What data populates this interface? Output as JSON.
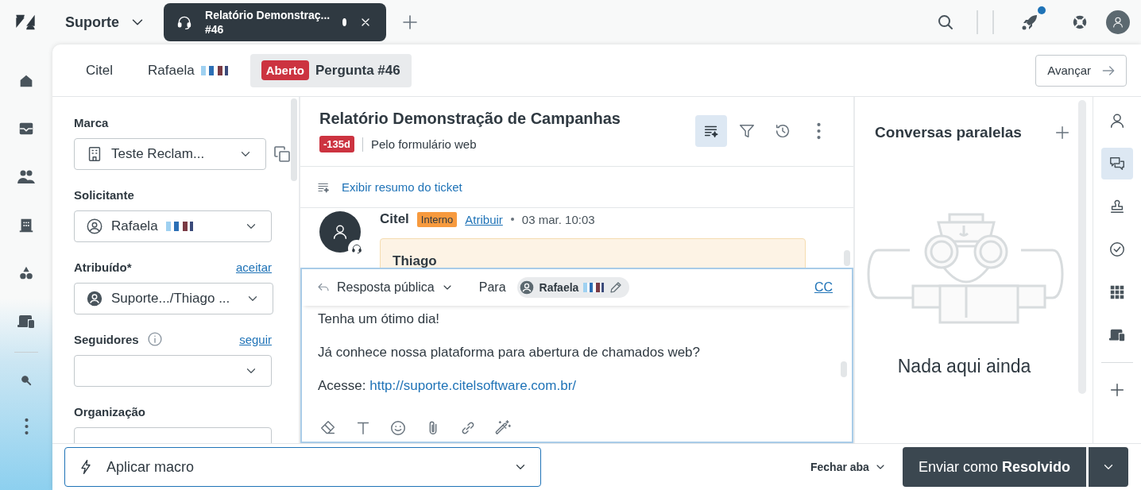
{
  "header": {
    "workspace": "Suporte",
    "open_tab": {
      "title": "Relatório Demonstraç...",
      "subtitle": "#46",
      "unsaved": true
    },
    "notification_dot": true
  },
  "breadcrumbs": [
    {
      "label": "Citel",
      "selected": false
    },
    {
      "label": "Rafaela",
      "redacted": true,
      "selected": false
    },
    {
      "label": "Pergunta #46",
      "status": "Aberto",
      "selected": true
    }
  ],
  "next_button": "Avançar",
  "properties": [
    {
      "kind": "brand",
      "label": "Marca",
      "value": "Teste Reclam..."
    },
    {
      "kind": "requester",
      "label": "Solicitante",
      "value": "Rafaela",
      "redacted": true
    },
    {
      "kind": "assignee",
      "label": "Atribuído*",
      "action": "aceitar",
      "value": "Suporte.../Thiago ..."
    },
    {
      "kind": "followers",
      "label": "Seguidores",
      "action": "seguir",
      "info": true
    },
    {
      "kind": "organization",
      "label": "Organização"
    }
  ],
  "ticket": {
    "title": "Relatório Demonstração de Campanhas",
    "sla": "-135d",
    "channel": "Pelo formulário web",
    "tools": [
      {
        "kind": "summary",
        "selected": true
      },
      {
        "kind": "filter",
        "selected": false
      },
      {
        "kind": "history",
        "selected": false
      },
      {
        "kind": "more",
        "selected": false
      }
    ],
    "summary_link": "Exibir resumo do ticket"
  },
  "message": {
    "author": "Citel",
    "tag": "Interno",
    "action": "Atribuir",
    "time": "03 mar. 10:03",
    "heading": "Thiago"
  },
  "composer": {
    "mode": "Resposta pública",
    "to_label": "Para",
    "recipient": "Rafaela",
    "recipient_redacted": true,
    "cc": "CC",
    "lines": [
      {
        "text": "Tenha um ótimo dia!"
      },
      {
        "text": "Já conhece nossa plataforma para abertura de chamados web?"
      },
      {
        "text": "Acesse: ",
        "link": "http://suporte.citelsoftware.com.br/"
      }
    ]
  },
  "side_panel": {
    "title": "Conversas paralelas",
    "empty_text": "Nada aqui ainda"
  },
  "rail": [
    {
      "kind": "user",
      "selected": false
    },
    {
      "kind": "chat",
      "selected": true
    },
    {
      "kind": "stamp",
      "selected": false
    },
    {
      "kind": "check",
      "selected": false
    },
    {
      "kind": "apps",
      "selected": false
    },
    {
      "kind": "devices",
      "selected": false
    },
    {
      "kind": "add",
      "selected": false
    }
  ],
  "footer": {
    "macro": "Aplicar macro",
    "close_tab": "Fechar aba",
    "submit": "Enviar como **Resolvido**"
  }
}
